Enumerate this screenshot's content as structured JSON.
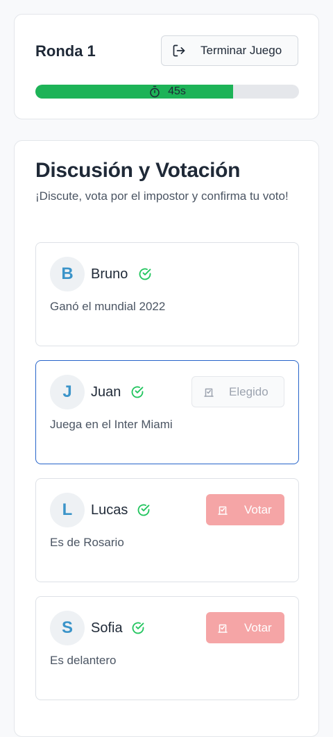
{
  "header": {
    "round_label": "Ronda 1",
    "end_game_label": "Terminar Juego",
    "timer_text": "45s",
    "timer_progress": 0.75
  },
  "discussion": {
    "title": "Discusión y Votación",
    "subtitle": "¡Discute, vota por el impostor y confirma tu voto!"
  },
  "players": [
    {
      "initial": "B",
      "name": "Bruno",
      "clue": "Ganó el mundial 2022",
      "confirmed": true,
      "action": "none"
    },
    {
      "initial": "J",
      "name": "Juan",
      "clue": "Juega en el Inter Miami",
      "confirmed": true,
      "action": "chosen",
      "action_label": "Elegido"
    },
    {
      "initial": "L",
      "name": "Lucas",
      "clue": "Es de Rosario",
      "confirmed": true,
      "action": "vote",
      "action_label": "Votar"
    },
    {
      "initial": "S",
      "name": "Sofia",
      "clue": "Es delantero",
      "confirmed": true,
      "action": "vote",
      "action_label": "Votar"
    }
  ],
  "colors": {
    "timer_fill": "#1db357",
    "avatar_letter": "#3b94c9",
    "check": "#22c55e",
    "vote_button": "#f5a5a6",
    "selected_border": "#2563c9"
  },
  "icons": {
    "end_game": "logout-icon",
    "timer": "stopwatch-icon",
    "confirmed": "check-circle-icon",
    "vote": "ballot-icon"
  }
}
